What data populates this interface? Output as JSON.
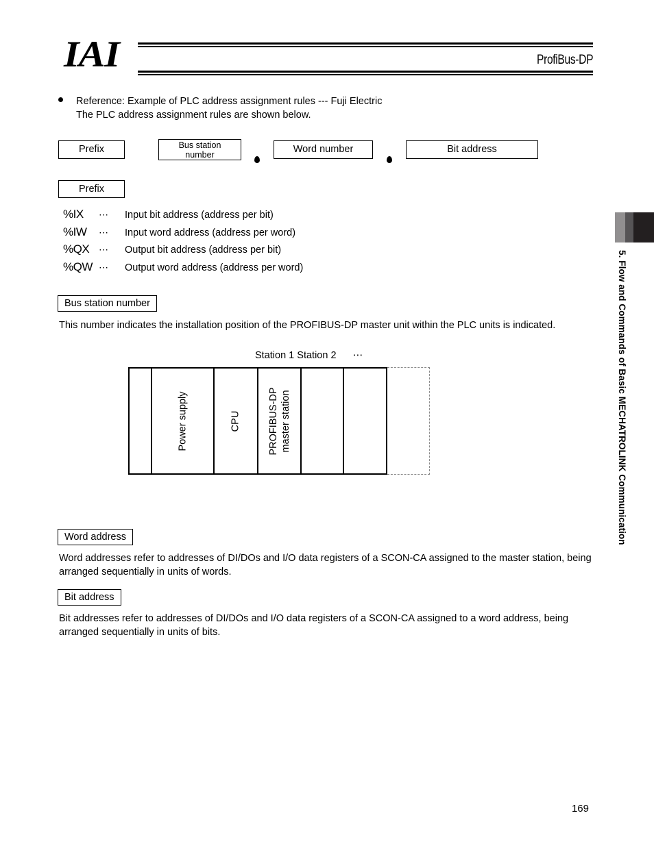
{
  "header": {
    "logo_text": "IAI",
    "title": "ProfiBus-DP"
  },
  "side_tab": {
    "chapter_label": "5. Flow and Commands of Basic MECHATROLINK Communication",
    "band_colors": [
      "#918f90",
      "#565456",
      "#231f20"
    ]
  },
  "intro": {
    "line1": "Reference: Example of PLC address assignment rules --- Fuji Electric",
    "line2": "The PLC address assignment rules are shown below."
  },
  "formula": {
    "prefix_label": "Prefix",
    "bus_station_label": "Bus station\nnumber",
    "bus_station_line1": "Bus station",
    "bus_station_line2": "number",
    "word_number_label": "Word number",
    "bit_address_label": "Bit address",
    "separator": "●"
  },
  "prefix_section": {
    "heading": "Prefix",
    "ellipsis": "⋯",
    "rows": [
      {
        "code": "%IX",
        "desc": "Input bit address (address per bit)"
      },
      {
        "code": "%IW",
        "desc": "Input word address (address per word)"
      },
      {
        "code": "%QX",
        "desc": "Output bit address (address per bit)"
      },
      {
        "code": "%QW",
        "desc": "Output word address (address per word)"
      }
    ]
  },
  "bus_station_section": {
    "heading": "Bus station number",
    "paragraph": "This number indicates the installation position of the PROFIBUS-DP master unit within the PLC units is indicated."
  },
  "rack_diagram": {
    "caption_station1": "Station 1",
    "caption_station2": "Station 2",
    "caption_ellipsis": "⋯",
    "cells": [
      {
        "label": ""
      },
      {
        "label": "Power supply"
      },
      {
        "label": "CPU"
      },
      {
        "label_line1": "PROFIBUS-DP",
        "label_line2": "master station"
      },
      {
        "label": ""
      },
      {
        "label": ""
      },
      {
        "label": ""
      }
    ]
  },
  "word_address_section": {
    "heading": "Word address",
    "paragraph": "Word addresses refer to addresses of DI/DOs and I/O data registers of a SCON-CA assigned to the master station, being arranged sequentially in units of words."
  },
  "bit_address_section": {
    "heading": "Bit address",
    "paragraph": "Bit addresses refer to addresses of DI/DOs and I/O data registers of a SCON-CA assigned to a word address, being arranged sequentially in units of bits."
  },
  "footer": {
    "page_number": "169"
  }
}
